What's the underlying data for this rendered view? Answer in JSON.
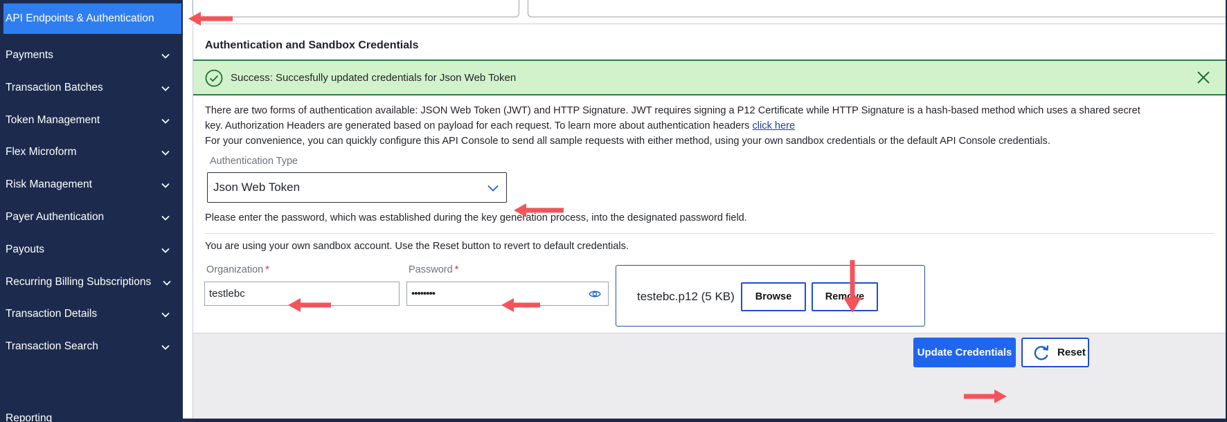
{
  "sidebar": {
    "active": "API Endpoints & Authentication",
    "items": [
      "Payments",
      "Transaction Batches",
      "Token Management",
      "Flex Microform",
      "Risk Management",
      "Payer Authentication",
      "Payouts",
      "Recurring Billing Subscriptions",
      "Transaction Details",
      "Transaction Search",
      "Reporting"
    ]
  },
  "panel": {
    "title": "Authentication and Sandbox Credentials"
  },
  "alert": {
    "text": "Success: Succesfully updated credentials for Json Web Token",
    "icon": "check-circle-icon",
    "close_icon": "close-icon"
  },
  "intro": {
    "line1": "There are two forms of authentication available: JSON Web Token (JWT) and HTTP Signature. JWT requires signing a P12 Certificate while HTTP Signature is a hash-based method which uses a shared secret",
    "line2": "key. Authorization Headers are generated based on payload for each request. To learn more about authentication headers",
    "link": "click here",
    "line3": "For your convenience, you can quickly configure this API Console to send all sample requests with either method, using your own sandbox credentials or the default API Console credentials."
  },
  "auth_type": {
    "label": "Authentication Type",
    "value": "Json Web Token"
  },
  "password_note": "Please enter the password, which was established during the key generation process, into the designated password field.",
  "sandbox_note": "You are using your own sandbox account. Use the Reset button to revert to default credentials.",
  "organization": {
    "label": "Organization",
    "required": "*",
    "value": "testlebc"
  },
  "password": {
    "label": "Password",
    "required": "*",
    "value": "••••••••"
  },
  "file": {
    "name": "testebc.p12 (5 KB)",
    "browse": "Browse",
    "remove": "Remove"
  },
  "footer": {
    "update": "Update Credentials",
    "reset": "Reset"
  },
  "colors": {
    "sidebar_bg": "#1c2b4d",
    "active_bg": "#2f7ef0",
    "primary": "#1f65f0",
    "success_bg": "#d2f2cb",
    "annotation_arrow": "#f2545b"
  }
}
